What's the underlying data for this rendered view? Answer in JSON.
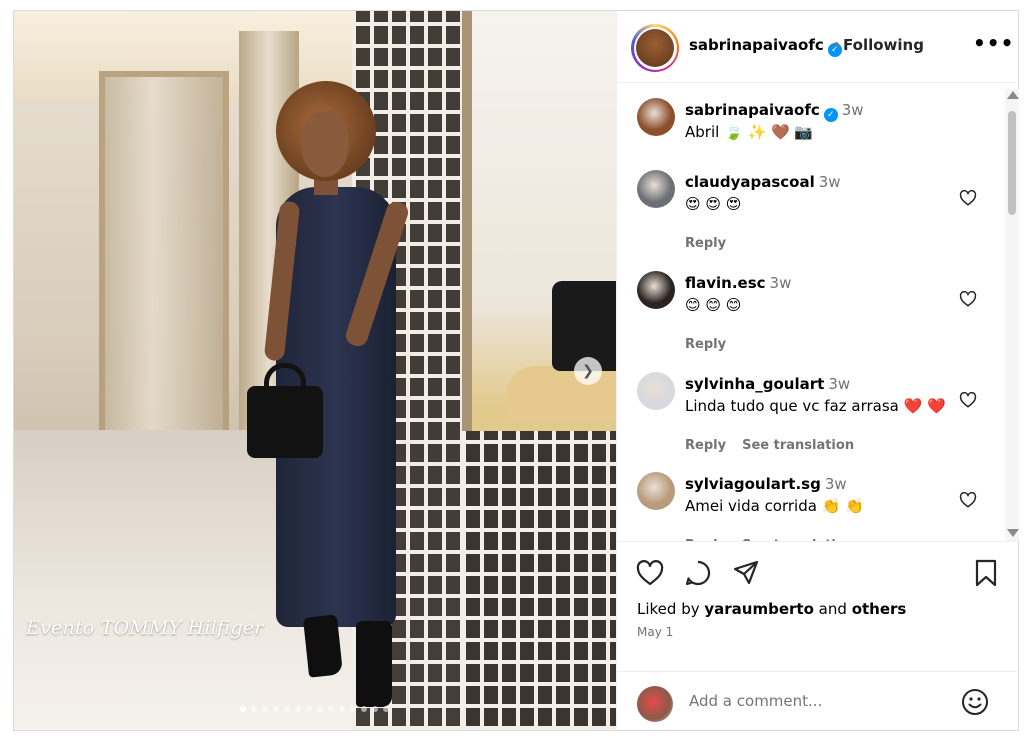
{
  "media": {
    "caption_overlay": "Evento TOMMY Hilfiger",
    "carousel_total": 14,
    "carousel_index": 1
  },
  "header": {
    "username": "sabrinapaivaofc",
    "separator": "•",
    "follow_status": "Following",
    "more_icon": "more-horizontal-icon"
  },
  "comments": [
    {
      "user": "sabrinapaivaofc",
      "time": "3w",
      "text": "Abril 🍃 ✨ 🤎 📷",
      "verified": true,
      "reply": "",
      "translate": "",
      "avatar_color": "#8b4f2a"
    },
    {
      "user": "claudyapascoal",
      "time": "3w",
      "text": "😍 😍 😍",
      "verified": false,
      "reply": "Reply",
      "translate": "",
      "avatar_color": "#6c6f74"
    },
    {
      "user": "flavin.esc",
      "time": "3w",
      "text": "😊 😊 😊",
      "verified": false,
      "reply": "Reply",
      "translate": "",
      "avatar_color": "#2b2320"
    },
    {
      "user": "sylvinha_goulart",
      "time": "3w",
      "text": "Linda tudo que vc faz arrasa ❤️ ❤️",
      "verified": false,
      "reply": "Reply",
      "translate": "See translation",
      "avatar_color": "#d8d8de"
    },
    {
      "user": "sylviagoulart.sg",
      "time": "3w",
      "text": "Amei vida corrida 👏 👏",
      "verified": false,
      "reply": "Reply",
      "translate": "See translation",
      "avatar_color": "#b99a7a"
    }
  ],
  "actions": {
    "liked_prefix": "Liked by",
    "liked_user": "yaraumberto",
    "liked_and": "and",
    "liked_others": "others",
    "date": "May 1"
  },
  "add_comment": {
    "placeholder": "Add a comment..."
  },
  "colors": {
    "verified": "#0095f6",
    "secondary_text": "#737373",
    "border": "#efefef"
  }
}
